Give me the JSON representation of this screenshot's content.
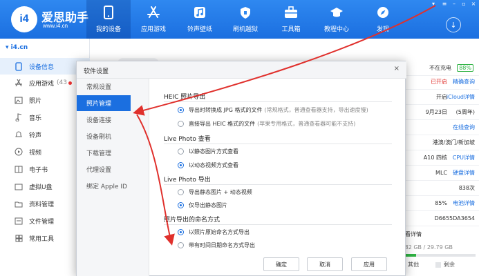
{
  "app": {
    "brand": "爱思助手",
    "url": "www.i4.cn",
    "logo_text": "i4"
  },
  "nav": [
    {
      "label": "我的设备",
      "icon": "phone-icon"
    },
    {
      "label": "应用游戏",
      "icon": "app-store-icon"
    },
    {
      "label": "铃声壁纸",
      "icon": "music-note-icon"
    },
    {
      "label": "刷机越狱",
      "icon": "shield-icon"
    },
    {
      "label": "工具箱",
      "icon": "toolbox-icon"
    },
    {
      "label": "教程中心",
      "icon": "graduation-cap-icon"
    },
    {
      "label": "发现",
      "icon": "compass-icon"
    }
  ],
  "sidebar": {
    "device": "i4.cn",
    "items": [
      {
        "label": "设备信息",
        "icon": "device-info-icon"
      },
      {
        "label": "应用游戏",
        "badge": "(43",
        "icon": "apps-icon"
      },
      {
        "label": "照片",
        "icon": "photo-icon"
      },
      {
        "label": "音乐",
        "icon": "music-icon"
      },
      {
        "label": "铃声",
        "icon": "bell-icon"
      },
      {
        "label": "视频",
        "icon": "video-icon"
      },
      {
        "label": "电子书",
        "icon": "book-icon"
      },
      {
        "label": "虚拟U盘",
        "icon": "usb-icon"
      },
      {
        "label": "资料管理",
        "icon": "folder-icon"
      },
      {
        "label": "文件管理",
        "icon": "file-icon"
      },
      {
        "label": "常用工具",
        "icon": "grid-icon"
      }
    ]
  },
  "info": {
    "charging": "不在充电",
    "battery": "88%",
    "rows": [
      {
        "value": "已开启",
        "link": "精确查询"
      },
      {
        "value": "开启",
        "link": "iCloud详情"
      },
      {
        "value": "9月23日",
        "link": "(5周年)"
      },
      {
        "value": "",
        "link": "在线查询"
      },
      {
        "value": "港澳/澳门/新加坡",
        "link": ""
      },
      {
        "value": "A10 四核",
        "link": "CPU详情"
      },
      {
        "value": "MLC",
        "link": "硬盘详情"
      },
      {
        "value": "838次",
        "link": ""
      },
      {
        "value": "85%",
        "link": "电池详情"
      },
      {
        "value": "D6655DA3654",
        "link": ""
      }
    ],
    "detail_label": "查看详情",
    "storage": "4.82 GB / 29.79 GB",
    "legend_other": "其他",
    "legend_free": "剩余"
  },
  "dialog": {
    "title": "软件设置",
    "nav": [
      "常规设置",
      "照片管理",
      "设备连接",
      "设备刷机",
      "下载管理",
      "代理设置",
      "绑定 Apple ID"
    ],
    "sections": [
      {
        "title": "HEIC 照片导出",
        "options": [
          {
            "label": "导出时转换成 JPG 格式的文件",
            "note": "(常规格式，普通查看器支持，导出速度慢)",
            "selected": true
          },
          {
            "label": "直接导出 HEIC 格式的文件",
            "note": "(苹果专用格式，普通查看器可能不支持)",
            "selected": false
          }
        ]
      },
      {
        "title": "Live Photo 查看",
        "options": [
          {
            "label": "以静态图片方式查看",
            "selected": false
          },
          {
            "label": "以动态视频方式查看",
            "selected": true
          }
        ]
      },
      {
        "title": "Live Photo 导出",
        "options": [
          {
            "label": "导出静态图片 + 动态视频",
            "selected": false
          },
          {
            "label": "仅导出静态图片",
            "selected": true
          }
        ]
      },
      {
        "title": "照片导出的命名方式",
        "options": [
          {
            "label": "以照片原始命名方式导出",
            "selected": true
          },
          {
            "label": "带有时间日期命名方式导出",
            "selected": false
          }
        ]
      }
    ],
    "buttons": {
      "ok": "确定",
      "cancel": "取消",
      "apply": "应用"
    }
  },
  "colors": {
    "accent": "#1b6fe0",
    "annotation": "#e0302c",
    "topbar": "#2f88f0"
  }
}
